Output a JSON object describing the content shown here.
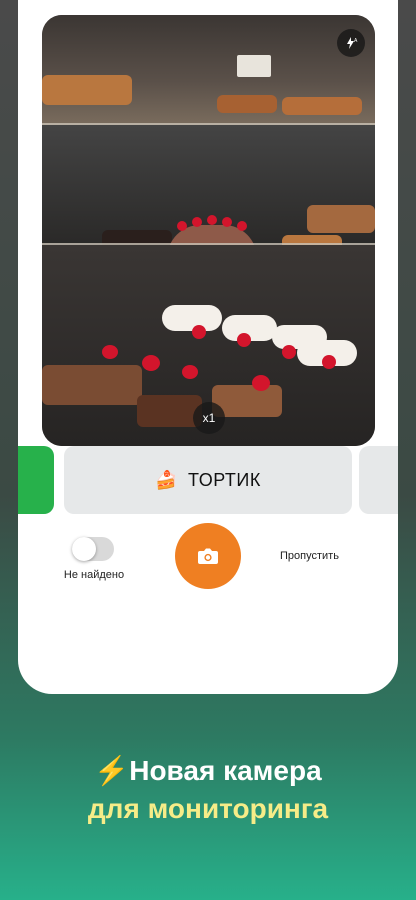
{
  "camera": {
    "zoom_label": "x1",
    "flash_icon": "flash-auto-icon"
  },
  "pager": {
    "dot_colors": [
      "#27b14b",
      "#27b14b",
      "#f28b8b",
      "#27b14b",
      "#1a1a1a",
      "#b9b9b9",
      "#b9b9b9",
      "#b9b9b9",
      "#b9b9b9"
    ],
    "active_index": 4
  },
  "categories": {
    "current": {
      "emoji": "🍰",
      "label": "ТОРТИК"
    }
  },
  "controls": {
    "toggle_label": "Не найдено",
    "toggle_on": false,
    "skip_label": "Пропустить",
    "shutter_icon": "camera-icon",
    "shutter_color": "#ef7f22"
  },
  "promo": {
    "line1_emoji": "⚡",
    "line1": "Новая камера",
    "line2": "для мониторинга"
  }
}
